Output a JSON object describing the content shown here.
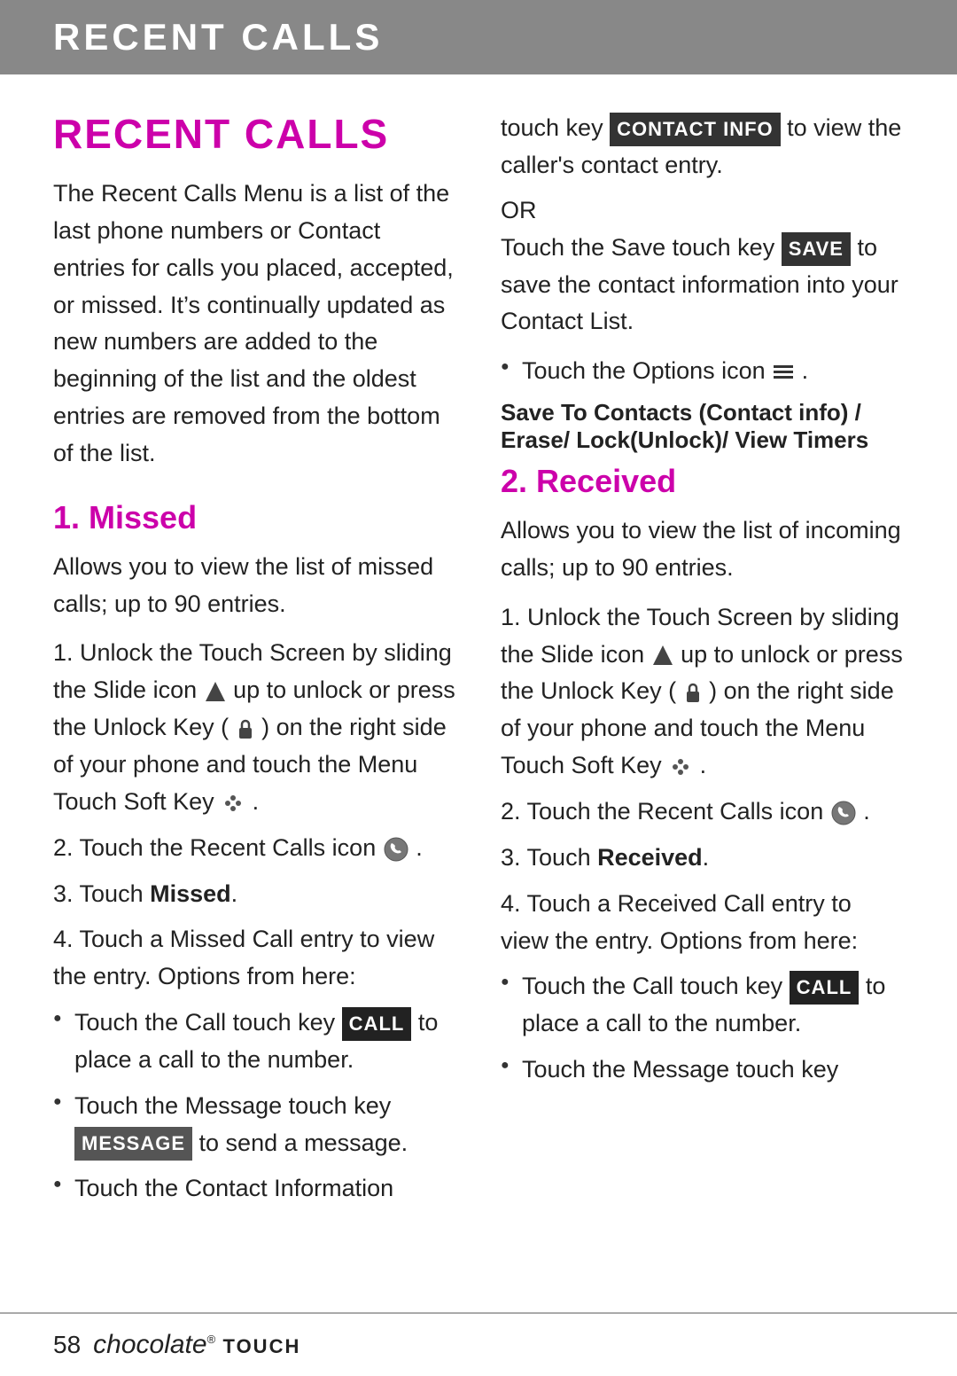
{
  "header": {
    "title": "RECENT CALLS"
  },
  "page_section_title": "RECENT CALLS",
  "intro": "The Recent Calls Menu is a list of the last phone numbers or Contact entries for calls you placed, accepted, or missed. It’s continually updated as new numbers are added to the beginning of the list and the oldest entries are removed from the bottom of the list.",
  "left_column": {
    "section1_heading": "1. Missed",
    "section1_intro": "Allows you to view the list of missed calls; up to 90 entries.",
    "section1_steps": [
      "1. Unlock the Touch Screen by sliding the Slide icon ▲ up to unlock or press the Unlock Key ( 🔒 ) on the right side of your phone and touch the Menu Touch Soft Key 🔧 .",
      "2. Touch the Recent Calls icon 📞 .",
      "3. Touch Missed.",
      "4. Touch a Missed Call entry to view the entry. Options from here:"
    ],
    "section1_bullets": [
      "Touch the Call touch key CALL to place a call to the number.",
      "Touch the Message touch key MESSAGE to send a message.",
      "Touch the Contact Information"
    ]
  },
  "right_column": {
    "right_top_text1": "touch key",
    "right_top_badge_contactinfo": "CONTACT INFO",
    "right_top_text2": "to view the caller’s contact entry.",
    "right_or": "OR",
    "right_save_text1": "Touch the Save touch key",
    "right_save_badge": "SAVE",
    "right_save_text2": "to save the contact information into your Contact List.",
    "right_options_bullet": "Touch the Options icon ≡ .",
    "right_options_submenu": "Save To Contacts (Contact info) / Erase/ Lock(Unlock)/ View Timers",
    "section2_heading": "2. Received",
    "section2_intro": "Allows you to view the list of incoming calls; up to 90 entries.",
    "section2_steps": [
      "1. Unlock the Touch Screen by sliding the Slide icon ▲ up to unlock or press the Unlock Key ( 🔒 ) on the right side of your phone and touch the Menu Touch Soft Key 🔧 .",
      "2. Touch the Recent Calls icon 📞 .",
      "3. Touch Received.",
      "4. Touch a Received Call entry to view the entry. Options from here:"
    ],
    "section2_bullets": [
      "Touch the Call touch key CALL to place a call to the number.",
      "Touch the Message touch key"
    ]
  },
  "footer": {
    "page_number": "58",
    "brand_name": "chocolate",
    "brand_suffix": "TOUCH"
  },
  "icons": {
    "slide_icon": "▲",
    "unlock_icon": "🔒",
    "menu_icon": "⋯",
    "phone_icon": "📞",
    "options_icon": "≡"
  },
  "badges": {
    "call": "CALL",
    "message": "MESSAGE",
    "save": "SAVE",
    "contact_info": "CONTACT INFO"
  }
}
